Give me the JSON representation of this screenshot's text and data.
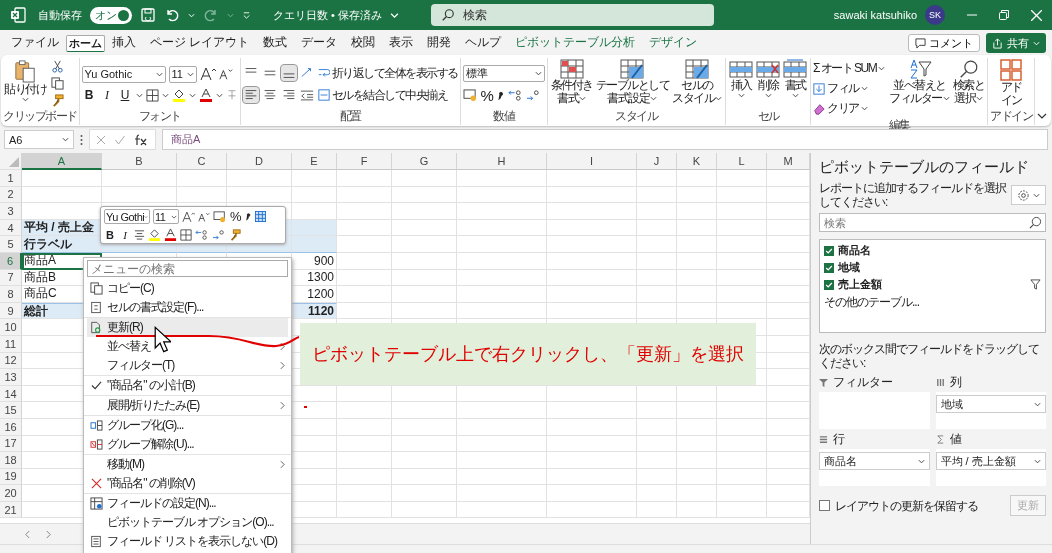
{
  "title_bar": {
    "autosave_label": "自動保存",
    "autosave_toggle": {
      "label": "オン",
      "on": true
    },
    "document_title": "クエリ日数 • 保存済み",
    "search_placeholder": "検索",
    "user_name": "sawaki katsuhiko",
    "avatar_initials": "SK"
  },
  "menu_tabs": [
    {
      "label": "ファイル",
      "selected": false,
      "kind": "plain"
    },
    {
      "label": "ホーム",
      "selected": true,
      "kind": "plain"
    },
    {
      "label": "挿入",
      "selected": false,
      "kind": "plain"
    },
    {
      "label": "ページ レイアウト",
      "selected": false,
      "kind": "plain"
    },
    {
      "label": "数式",
      "selected": false,
      "kind": "plain"
    },
    {
      "label": "データ",
      "selected": false,
      "kind": "plain"
    },
    {
      "label": "校閲",
      "selected": false,
      "kind": "plain"
    },
    {
      "label": "表示",
      "selected": false,
      "kind": "plain"
    },
    {
      "label": "開発",
      "selected": false,
      "kind": "plain"
    },
    {
      "label": "ヘルプ",
      "selected": false,
      "kind": "plain"
    },
    {
      "label": "ピボットテーブル分析",
      "selected": false,
      "kind": "context"
    },
    {
      "label": "デザイン",
      "selected": false,
      "kind": "context"
    }
  ],
  "comment_button": "コメント",
  "share_button": "共有",
  "ribbon": {
    "clipboard": {
      "paste": "貼り付け",
      "label": "クリップボード"
    },
    "font": {
      "font_name": "Yu Gothic",
      "font_size": "11",
      "bold": "B",
      "italic": "I",
      "underline": "U",
      "label": "フォント"
    },
    "alignment": {
      "vertical_buttons": [
        {
          "selected": false
        },
        {
          "selected": false
        },
        {
          "selected": true
        }
      ],
      "horizontal_buttons": [
        {
          "selected": true
        },
        {
          "selected": false
        },
        {
          "selected": false
        }
      ],
      "wrap_text": "折り返して全体を表示する",
      "merge_center": "セルを結合して中央揃え",
      "label": "配置"
    },
    "number": {
      "format": "標準",
      "percent": "%",
      "label": "数値"
    },
    "styles": {
      "buttons": [
        [
          "条件付き",
          "書式"
        ],
        [
          "テーブルとして",
          "書式設定"
        ],
        [
          "セルの",
          "スタイル"
        ]
      ],
      "label": "スタイル"
    },
    "cells": {
      "buttons": [
        "挿入",
        "削除",
        "書式"
      ],
      "label": "セル"
    },
    "editing": {
      "autosum": "オート SUM",
      "sigma": "Σ",
      "fill": "フィル",
      "clear": "クリア",
      "sort_filter": [
        "並べ替えと",
        "フィルター"
      ],
      "find_select": [
        "検索と",
        "選択"
      ],
      "label": "編集"
    },
    "addins": {
      "button": [
        "アド",
        "イン"
      ],
      "label": "アドイン"
    }
  },
  "formula_bar": {
    "name_box": "A6",
    "formula": "商品A"
  },
  "sheet": {
    "columns": [
      {
        "label": "A",
        "selected": true
      },
      {
        "label": "B",
        "selected": false
      },
      {
        "label": "C",
        "selected": false
      },
      {
        "label": "D",
        "selected": false
      },
      {
        "label": "E",
        "selected": false
      },
      {
        "label": "F",
        "selected": false
      },
      {
        "label": "G",
        "selected": false
      },
      {
        "label": "H",
        "selected": false
      },
      {
        "label": "I",
        "selected": false
      },
      {
        "label": "J",
        "selected": false
      },
      {
        "label": "K",
        "selected": false
      },
      {
        "label": "L",
        "selected": false
      },
      {
        "label": "M",
        "selected": false
      }
    ],
    "rows": [
      {
        "header": "1",
        "selected": false,
        "kind": "empty"
      },
      {
        "header": "2",
        "selected": false,
        "kind": "empty"
      },
      {
        "header": "3",
        "selected": false,
        "kind": "empty"
      },
      {
        "header": "4",
        "selected": false,
        "kind": "pivot-title",
        "cells": {
          "A": {
            "text": "平均 / 売上金",
            "kind": "text",
            "selected": false
          }
        }
      },
      {
        "header": "5",
        "selected": false,
        "kind": "pivot-header",
        "cells": {
          "A": {
            "text": "行ラベル",
            "kind": "text",
            "selected": false
          }
        }
      },
      {
        "header": "6",
        "selected": true,
        "kind": "pivot-item",
        "cells": {
          "A": {
            "text": "商品A",
            "kind": "text",
            "selected": true
          },
          "E": {
            "text": "900",
            "kind": "number",
            "selected": false
          }
        }
      },
      {
        "header": "7",
        "selected": false,
        "kind": "pivot-item",
        "cells": {
          "A": {
            "text": "商品B",
            "kind": "text",
            "selected": false
          },
          "E": {
            "text": "1300",
            "kind": "number",
            "selected": false
          }
        }
      },
      {
        "header": "8",
        "selected": false,
        "kind": "pivot-item",
        "cells": {
          "A": {
            "text": "商品C",
            "kind": "text",
            "selected": false
          },
          "E": {
            "text": "1200",
            "kind": "number",
            "selected": false
          }
        }
      },
      {
        "header": "9",
        "selected": false,
        "kind": "pivot-total",
        "cells": {
          "A": {
            "text": "総計",
            "kind": "text",
            "selected": false
          },
          "E": {
            "text": "1120",
            "kind": "number",
            "selected": false
          }
        }
      },
      {
        "header": "10",
        "selected": false,
        "kind": "empty"
      },
      {
        "header": "11",
        "selected": false,
        "kind": "empty"
      },
      {
        "header": "12",
        "selected": false,
        "kind": "empty"
      },
      {
        "header": "13",
        "selected": false,
        "kind": "empty"
      },
      {
        "header": "14",
        "selected": false,
        "kind": "empty"
      },
      {
        "header": "15",
        "selected": false,
        "kind": "empty"
      },
      {
        "header": "16",
        "selected": false,
        "kind": "empty"
      },
      {
        "header": "17",
        "selected": false,
        "kind": "empty"
      },
      {
        "header": "18",
        "selected": false,
        "kind": "empty"
      },
      {
        "header": "19",
        "selected": false,
        "kind": "empty"
      },
      {
        "header": "20",
        "selected": false,
        "kind": "empty"
      },
      {
        "header": "21",
        "selected": false,
        "kind": "empty"
      }
    ]
  },
  "mini_toolbar": {
    "font_name": "Yu Gothi",
    "font_size": "11",
    "percent": "%",
    "bold": "B",
    "italic": "I"
  },
  "context_menu": {
    "search_placeholder": "メニューの検索",
    "items": [
      {
        "kind": "item",
        "label": "コピー(C)",
        "selected": false,
        "checked": false,
        "submenu": false
      },
      {
        "kind": "item",
        "label": "セルの書式設定(F)...",
        "selected": false,
        "checked": false,
        "submenu": false
      },
      {
        "kind": "separator"
      },
      {
        "kind": "item",
        "label": "更新(R)",
        "selected": true,
        "checked": false,
        "submenu": false
      },
      {
        "kind": "item",
        "label": "並べ替え",
        "selected": false,
        "checked": false,
        "submenu": true
      },
      {
        "kind": "item",
        "label": "フィルター(T)",
        "selected": false,
        "checked": false,
        "submenu": true
      },
      {
        "kind": "separator"
      },
      {
        "kind": "item",
        "label": "\"商品名\" の小計(B)",
        "selected": false,
        "checked": true,
        "submenu": false
      },
      {
        "kind": "separator"
      },
      {
        "kind": "item",
        "label": "展開/折りたたみ(E)",
        "selected": false,
        "checked": false,
        "submenu": true
      },
      {
        "kind": "separator"
      },
      {
        "kind": "item",
        "label": "グループ化(G)...",
        "selected": false,
        "checked": false,
        "submenu": false
      },
      {
        "kind": "item",
        "label": "グループ解除(U)...",
        "selected": false,
        "checked": false,
        "submenu": false
      },
      {
        "kind": "separator"
      },
      {
        "kind": "item",
        "label": "移動(M)",
        "selected": false,
        "checked": false,
        "submenu": true
      },
      {
        "kind": "item",
        "label": "\"商品名\" の削除(V)",
        "selected": false,
        "checked": false,
        "submenu": false
      },
      {
        "kind": "separator"
      },
      {
        "kind": "item",
        "label": "フィールドの設定(N)...",
        "selected": false,
        "checked": false,
        "submenu": false
      },
      {
        "kind": "item",
        "label": "ピボットテーブル オプション(O)...",
        "selected": false,
        "checked": false,
        "submenu": false
      },
      {
        "kind": "item",
        "label": "フィールド リストを表示しない(D)",
        "selected": false,
        "checked": false,
        "submenu": false
      }
    ]
  },
  "annotation": {
    "text": "ピボットテーブル上で右クリックし、「更新」を選択"
  },
  "task_pane": {
    "title": "ピボットテーブルのフィールド",
    "instruction": "レポートに追加するフィールドを選択してください:",
    "search_placeholder": "検索",
    "fields": [
      {
        "label": "商品名",
        "checked": true,
        "filtered": false
      },
      {
        "label": "地域",
        "checked": true,
        "filtered": false
      },
      {
        "label": "売上金額",
        "checked": true,
        "filtered": true
      }
    ],
    "more_tables": "その他のテーブル...",
    "drag_instruction": "次のボックス間でフィールドをドラッグしてください:",
    "areas": [
      {
        "kind": "filters",
        "label": "フィルター"
      },
      {
        "kind": "columns",
        "label": "列",
        "fields": [
          "地域"
        ]
      },
      {
        "kind": "rows",
        "label": "行",
        "fields": [
          "商品名"
        ]
      },
      {
        "kind": "values",
        "label": "値",
        "fields": [
          "平均 / 売上金額"
        ]
      }
    ],
    "defer_update": {
      "label": "レイアウトの更新を保留する",
      "checked": false
    },
    "update_button": {
      "label": "更新",
      "disabled": true
    }
  }
}
